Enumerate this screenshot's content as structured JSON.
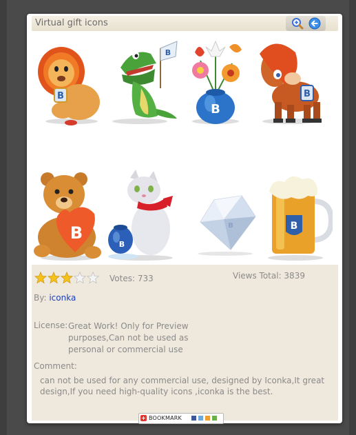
{
  "window": {
    "title": "Virtual gift icons"
  },
  "toolbar": {
    "zoom_icon": "magnifier-plus-icon",
    "back_icon": "arrow-left-icon"
  },
  "icons": [
    "lion-icon",
    "crocodile-icon",
    "flower-vase-icon",
    "pony-icon",
    "teddy-bear-icon",
    "cat-icon",
    "diamond-icon",
    "beer-mug-icon"
  ],
  "rating": {
    "stars_filled": 3,
    "stars_total": 5,
    "votes_label": "Votes: 733"
  },
  "stats": {
    "views_label": "Views Total: 3839"
  },
  "author": {
    "by_label": "By:",
    "name": "iconka"
  },
  "license": {
    "label": "License:",
    "text": "Great Work! Only for Preview purposes,Can not be used as personal or commercial use"
  },
  "comment": {
    "label": "Comment:",
    "text": "can not be used for any commercial use, designed by Iconka,It great design,If you need high-quality icons ,iconka is the best."
  },
  "bookmark": {
    "label": "BOOKMARK"
  },
  "colors": {
    "star": "#f5c21b",
    "link": "#1a3db8",
    "panel": "#efe9dd"
  }
}
